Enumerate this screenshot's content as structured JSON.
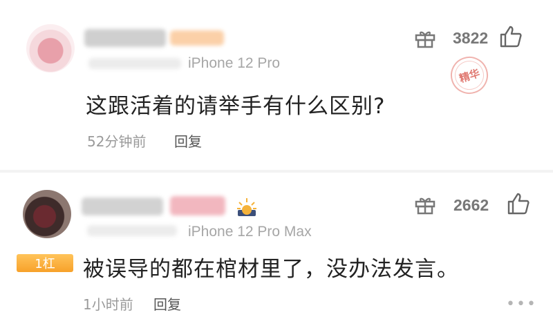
{
  "comments": [
    {
      "device": "iPhone 12 Pro",
      "content": "这跟活着的请举手有什么区别?",
      "time": "52分钟前",
      "reply_label": "回复",
      "likes": "3822",
      "stamp_label": "精华"
    },
    {
      "device": "iPhone 12 Pro Max",
      "content": "被误导的都在棺材里了，没办法发言。",
      "time": "1小时前",
      "reply_label": "回复",
      "likes": "2662",
      "badge_label": "1杠",
      "more_label": "•••"
    }
  ],
  "colors": {
    "badge": "#f7a12a",
    "stamp": "#e07a72",
    "divider": "#f3f3f3"
  },
  "icons": [
    "gift-icon",
    "thumbs-up-icon",
    "sun-badge-icon",
    "more-icon"
  ]
}
